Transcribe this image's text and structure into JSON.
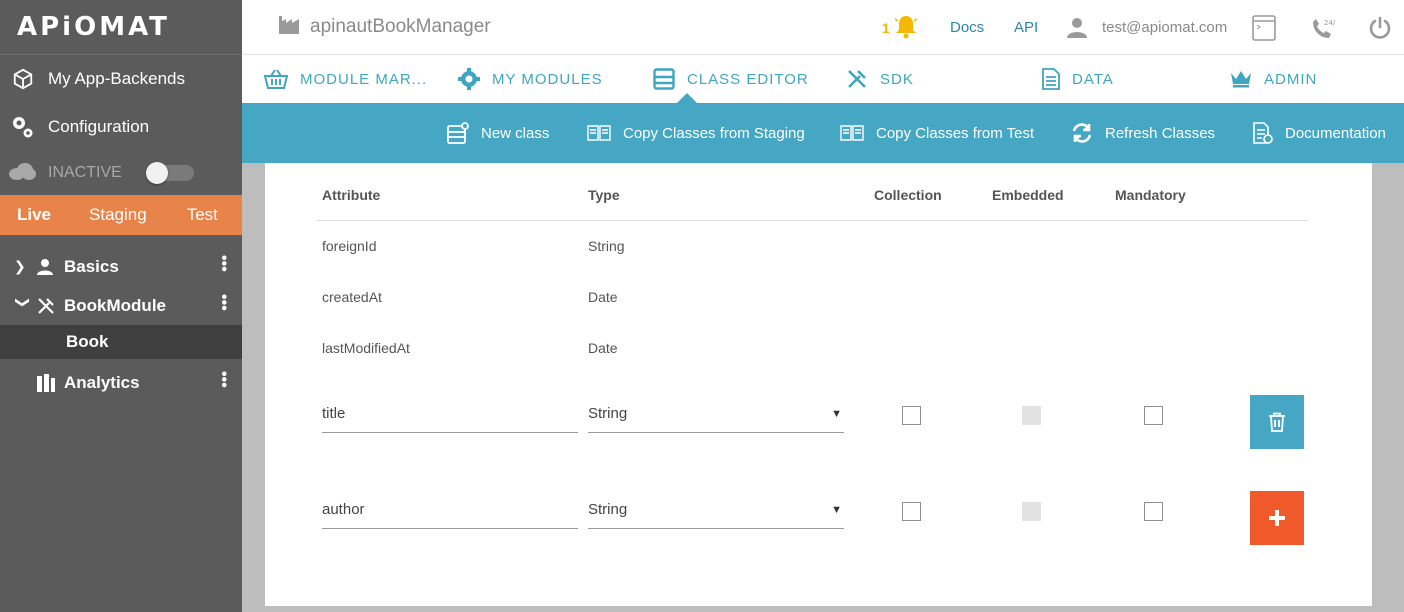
{
  "sidebar": {
    "logo": "APiOMAT",
    "items": [
      {
        "label": "My App-Backends"
      },
      {
        "label": "Configuration"
      }
    ],
    "status_label": "INACTIVE",
    "env_tabs": [
      "Live",
      "Staging",
      "Test"
    ],
    "tree": {
      "basics": "Basics",
      "bookmodule": "BookModule",
      "book": "Book",
      "analytics": "Analytics"
    }
  },
  "header": {
    "app_title": "apinautBookManager",
    "notification_count": "1",
    "docs": "Docs",
    "api": "API",
    "user_email": "test@apiomat.com"
  },
  "nav": {
    "tabs": [
      {
        "label": "MODULE MAR..."
      },
      {
        "label": "MY MODULES"
      },
      {
        "label": "CLASS EDITOR"
      },
      {
        "label": "SDK"
      },
      {
        "label": "DATA"
      },
      {
        "label": "ADMIN"
      }
    ]
  },
  "actions": {
    "new_class": "New class",
    "copy_staging": "Copy Classes from Staging",
    "copy_test": "Copy Classes from Test",
    "refresh": "Refresh Classes",
    "documentation": "Documentation"
  },
  "table": {
    "headers": {
      "attribute": "Attribute",
      "type": "Type",
      "collection": "Collection",
      "embedded": "Embedded",
      "mandatory": "Mandatory"
    },
    "fixed_rows": [
      {
        "attribute": "foreignId",
        "type": "String"
      },
      {
        "attribute": "createdAt",
        "type": "Date"
      },
      {
        "attribute": "lastModifiedAt",
        "type": "Date"
      }
    ],
    "edit_rows": [
      {
        "attribute": "title",
        "type": "String"
      },
      {
        "attribute": "author",
        "type": "String"
      }
    ]
  },
  "colors": {
    "accent": "#45a7c3",
    "sidebar": "#5b5b5b",
    "env_bar": "#e8834a",
    "add_button": "#f05a2a"
  }
}
